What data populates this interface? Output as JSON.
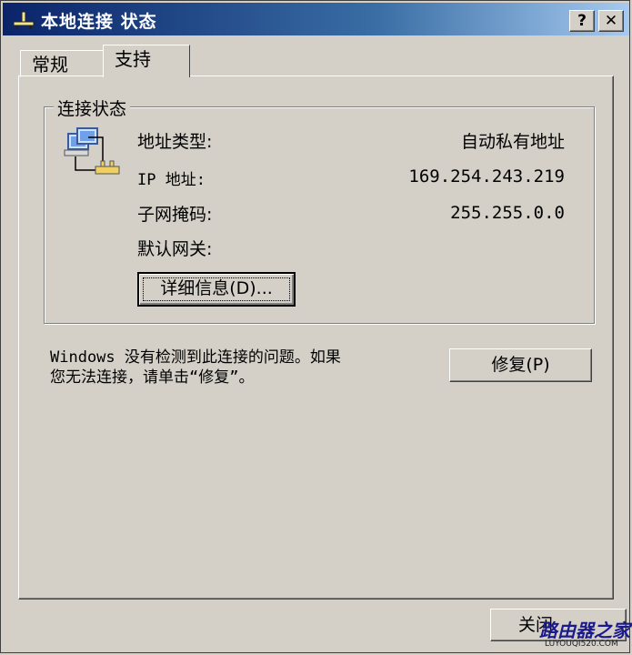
{
  "window": {
    "title": "本地连接 状态",
    "help_button": "?",
    "close_glyph": "✕"
  },
  "tabs": [
    {
      "label": "常规",
      "active": false
    },
    {
      "label": "支持",
      "active": true
    }
  ],
  "connection_status": {
    "legend": "连接状态",
    "icon": "network-connection-icon",
    "rows": [
      {
        "label": "地址类型:",
        "value": "自动私有地址"
      },
      {
        "label": "IP 地址:",
        "value": "169.254.243.219"
      },
      {
        "label": "子网掩码:",
        "value": "255.255.0.0"
      },
      {
        "label": "默认网关:",
        "value": ""
      }
    ],
    "details_button": "详细信息(D)..."
  },
  "support": {
    "message_line1": "Windows 没有检测到此连接的问题。如果",
    "message_line2": "您无法连接，请单击“修复”。",
    "repair_button": "修复(P)"
  },
  "footer": {
    "close_button": "关闭"
  },
  "watermark": {
    "text": "路由器之家",
    "url": "LUYOUQI520.COM"
  }
}
